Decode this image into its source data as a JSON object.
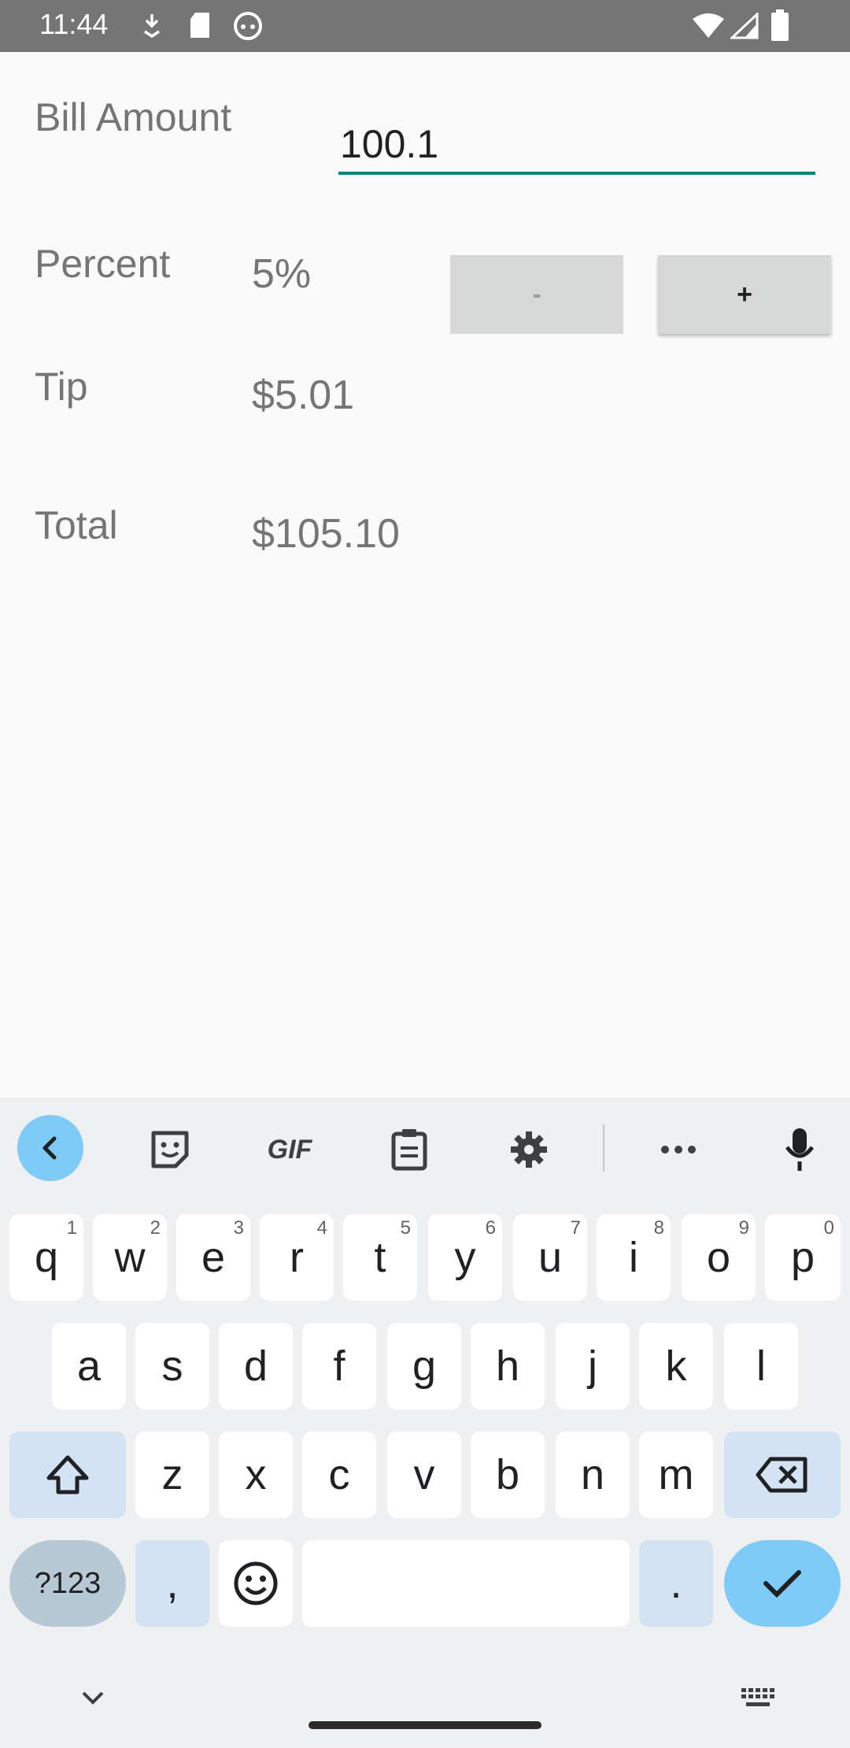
{
  "status_bar": {
    "time": "11:44",
    "icons": [
      "download-icon",
      "sd-card-icon",
      "android-icon",
      "wifi-icon",
      "signal-icon",
      "battery-icon"
    ]
  },
  "form": {
    "bill_label": "Bill Amount",
    "bill_value": "100.1",
    "percent_label": "Percent",
    "percent_value": "5%",
    "minus_label": "-",
    "plus_label": "+",
    "tip_label": "Tip",
    "tip_value": "$5.01",
    "total_label": "Total",
    "total_value": "$105.10"
  },
  "keyboard": {
    "toolbar": [
      "back-icon",
      "sticker-icon",
      "gif-icon",
      "clipboard-icon",
      "settings-icon",
      "more-icon",
      "mic-icon"
    ],
    "gif_label": "GIF",
    "row1": [
      {
        "k": "q",
        "h": "1"
      },
      {
        "k": "w",
        "h": "2"
      },
      {
        "k": "e",
        "h": "3"
      },
      {
        "k": "r",
        "h": "4"
      },
      {
        "k": "t",
        "h": "5"
      },
      {
        "k": "y",
        "h": "6"
      },
      {
        "k": "u",
        "h": "7"
      },
      {
        "k": "i",
        "h": "8"
      },
      {
        "k": "o",
        "h": "9"
      },
      {
        "k": "p",
        "h": "0"
      }
    ],
    "row2": [
      "a",
      "s",
      "d",
      "f",
      "g",
      "h",
      "j",
      "k",
      "l"
    ],
    "row3": [
      "z",
      "x",
      "c",
      "v",
      "b",
      "n",
      "m"
    ],
    "sym_label": "?123",
    "comma_label": ",",
    "period_label": "."
  },
  "colors": {
    "accent": "#00897b",
    "status_bar": "#757575",
    "keyboard_accent": "#7fcbf7"
  }
}
